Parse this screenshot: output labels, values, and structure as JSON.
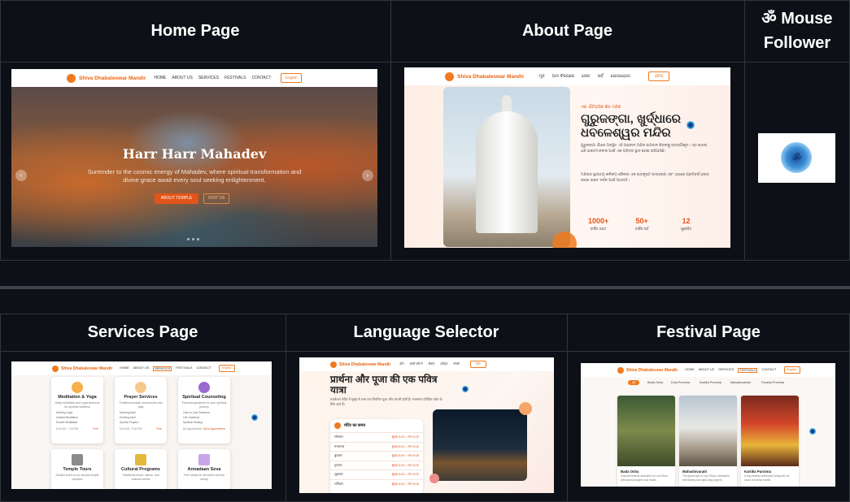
{
  "headers": {
    "home": "Home Page",
    "about": "About Page",
    "mouse": "ॐ Mouse Follower",
    "services": "Services Page",
    "language": "Language Selector",
    "festival": "Festival Page"
  },
  "site": {
    "brand": "Shiva Dhabaleswar Mandir",
    "nav": [
      "HOME",
      "ABOUT US",
      "SERVICES",
      "FESTIVALS",
      "CONTACT"
    ],
    "lang_button": "English",
    "om": "ॐ"
  },
  "home": {
    "title": "Harr Harr Mahadev",
    "subtitle": "Surrender to the cosmic energy of Mahadev, where spiritual transformation and divine grace await every soul seeking enlightenment.",
    "cta": "ABOUT TEMPLE",
    "cta2": "VISIT US",
    "prev": "‹",
    "next": "›"
  },
  "about": {
    "nav": [
      "ମୂଳ",
      "ଆମ ବିଷୟରେ",
      "ସେବା",
      "ପର୍ବ",
      "ଯୋଗାଯୋଗ"
    ],
    "lang_button": "ଓଡ଼ିଆ",
    "eyebrow": "ଏକ ଐତିହାସିକ ଶିବ ମନ୍ଦିର",
    "title": "ଗୁରୁଜଙ୍ଗା, ଖୁର୍ଦ୍ଧାରେ ଧବଳେଶ୍ୱର ମନ୍ଦିର",
    "p1": "ଗୁରୁଜଙ୍ଗା ଗାଁରେ ଅବସ୍ଥିତ ଏହି ପ୍ରାଚୀନ ମନ୍ଦିର ଭଗବାନ ଶିବଙ୍କୁ ଉତ୍ସର୍ଗୀକୃତ। ଏହା ଶତାବ୍ଦୀ ଧରି ଭକ୍ତମାନଙ୍କ ପାଇଁ ଏକ ପବିତ୍ର ସ୍ଥାନ ହୋଇ ରହିଆସିଛି।",
    "p2": "ମନ୍ଦିରର ସ୍ଥାପତ୍ୟ କଳିଙ୍ଗ ଶୈଳୀର ଏକ ଉତ୍କୃଷ୍ଟ ଉଦାହରଣ ଏବଂ ଏଠାରେ ପ୍ରତିବର୍ଷ ହଜାର ହଜାର ଭକ୍ତ ଦର୍ଶନ ପାଇଁ ଆସନ୍ତି।",
    "stats": [
      {
        "n": "1000+",
        "l": "ବାର୍ଷିକ ଭକ୍ତ"
      },
      {
        "n": "50+",
        "l": "ବାର୍ଷିକ ପର୍ବ"
      },
      {
        "n": "12",
        "l": "ପୁରୋହିତ"
      }
    ]
  },
  "services": {
    "cards": [
      {
        "title": "Meditation & Yoga",
        "desc": "Daily meditation and yoga sessions for spiritual wellness",
        "items": [
          "Morning Yoga",
          "Guided Meditation",
          "Sunset Meditation"
        ],
        "time": "6:00 AM - 7:00 PM",
        "link": "Free"
      },
      {
        "title": "Prayer Services",
        "desc": "Traditional prayer ceremonies and puja",
        "items": [
          "Morning Aarti",
          "Evening Aarti",
          "Special Prayers"
        ],
        "time": "6:00 AM - 9:00 PM",
        "link": "Free"
      },
      {
        "title": "Spiritual Counseling",
        "desc": "Personal guidance for your spiritual journey",
        "items": [
          "One-on-One Sessions",
          "Life Guidance",
          "Spiritual Healing"
        ],
        "time": "By Appointment",
        "link": "Book Appointment"
      },
      {
        "title": "Temple Tours",
        "desc": "Guided tours of our sacred temple complex",
        "items": [],
        "time": "",
        "link": ""
      },
      {
        "title": "Cultural Programs",
        "desc": "Traditional music, dance, and cultural events",
        "items": [],
        "time": "",
        "link": ""
      },
      {
        "title": "Annadaan Seva",
        "desc": "Free meals for devotees and the needy",
        "items": [],
        "time": "",
        "link": ""
      }
    ]
  },
  "language": {
    "nav": [
      "होम",
      "हमारे बारे में",
      "सेवाएं",
      "त्योहार",
      "संपर्क"
    ],
    "lang_button": "हिंदी",
    "title": "प्रार्थना और पूजा की एक पवित्र यात्रा",
    "p": "धवलेश्वर मंदिर में सुबह से शाम तक नियमित पूजा और आरती होती है। भक्तगण प्रतिदिन दर्शन के लिए आते हैं।",
    "timing_title": "मंदिर का समय",
    "rows": [
      {
        "day": "सोमवार",
        "time": "सुबह 5:00 - रात 9:00"
      },
      {
        "day": "मंगलवार",
        "time": "सुबह 5:00 - रात 9:00"
      },
      {
        "day": "बुधवार",
        "time": "सुबह 5:00 - रात 9:00"
      },
      {
        "day": "गुरुवार",
        "time": "सुबह 5:00 - रात 9:00"
      },
      {
        "day": "शुक्रवार",
        "time": "सुबह 5:00 - रात 9:00"
      },
      {
        "day": "शनिवार",
        "time": "सुबह 5:00 - रात 9:00"
      }
    ]
  },
  "festival": {
    "tabs": [
      "All",
      "Bada Osha",
      "Dola Purnima",
      "Kartika Purnima",
      "Mahashivaratri",
      "Pausha Purnima"
    ],
    "cards": [
      {
        "title": "Bada Osha",
        "desc": "A sacred festival dedicated to Lord Shiva with special prayers and rituals."
      },
      {
        "title": "Mahashivaratri",
        "desc": "The great night of Lord Shiva, celebrated with fasting and night-long prayers."
      },
      {
        "title": "Kartika Purnima",
        "desc": "A holy festival celebrated during the full moon of Kartika month."
      }
    ]
  },
  "colors": {
    "accent": "#f07a1f",
    "brand": "#e8650f",
    "bg": "#0d1117",
    "border": "#30363d"
  }
}
